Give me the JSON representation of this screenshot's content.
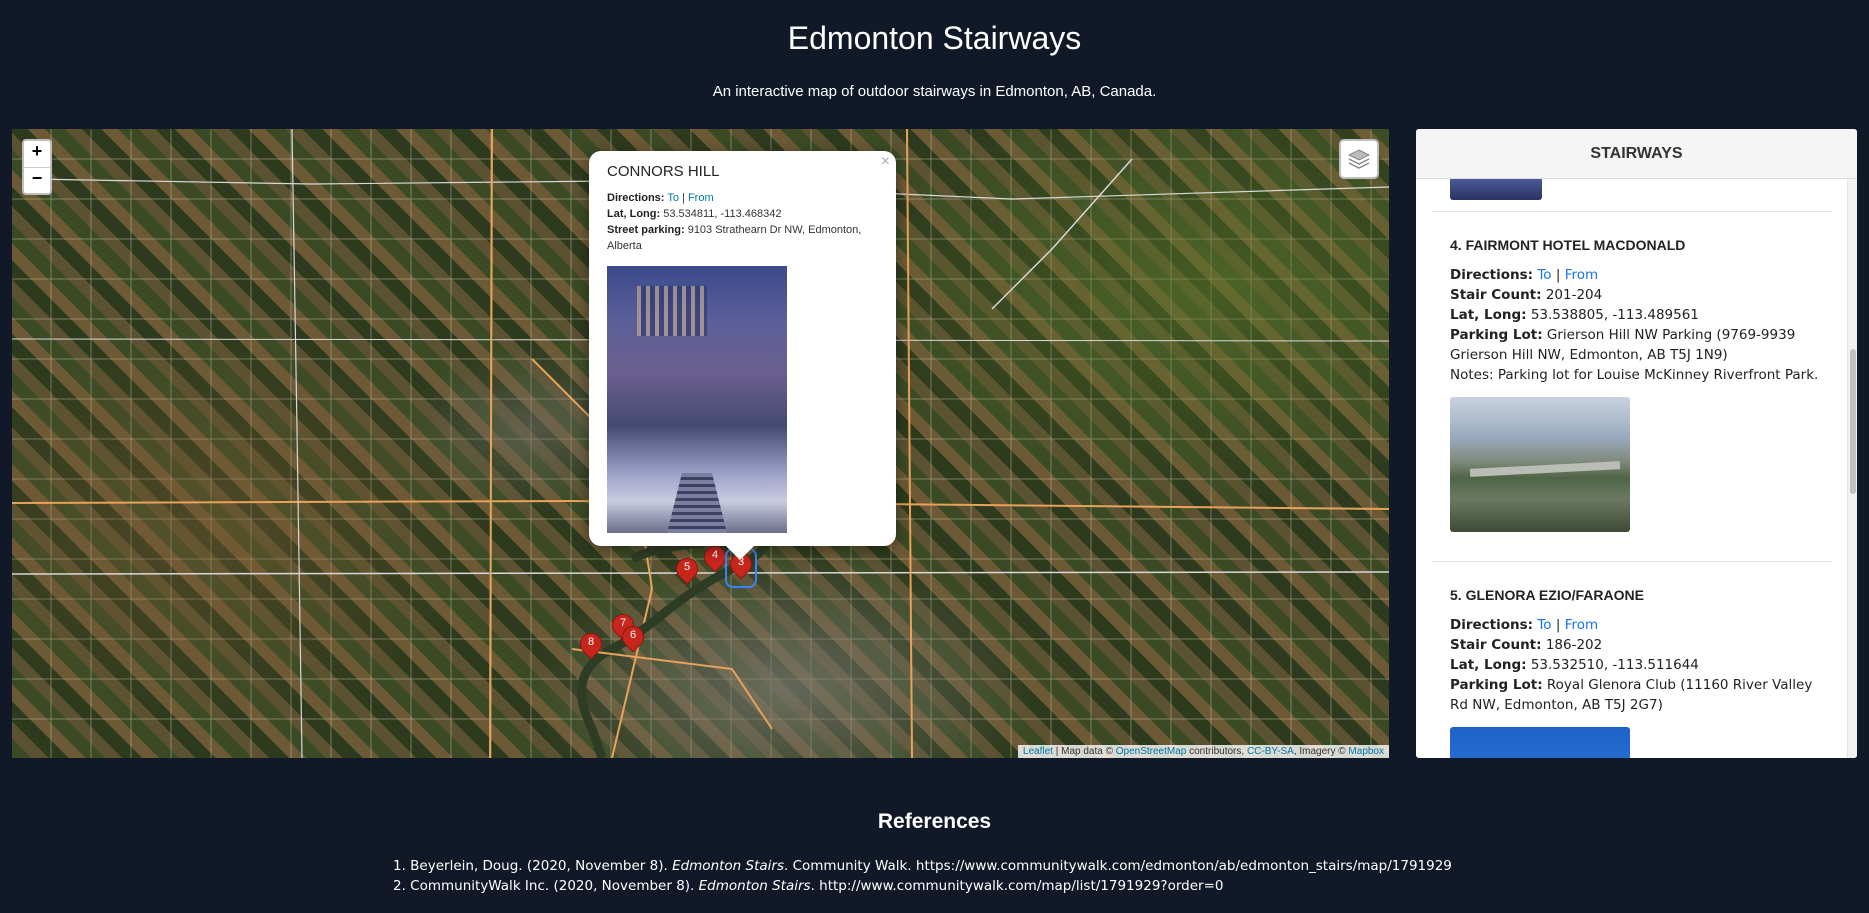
{
  "header": {
    "title": "Edmonton Stairways",
    "subtitle": "An interactive map of outdoor stairways in Edmonton, AB, Canada."
  },
  "map": {
    "zoom_in": "+",
    "zoom_out": "−",
    "layers_icon": "layers-icon",
    "markers": [
      "3",
      "4",
      "5",
      "6",
      "7",
      "8"
    ],
    "marker_color": "#c7261c",
    "attribution": {
      "leaflet": "Leaflet",
      "sep1": " | Map data © ",
      "osm": "OpenStreetMap",
      "contributors": " contributors, ",
      "license": "CC-BY-SA",
      "imagery": ", Imagery © ",
      "mapbox": "Mapbox"
    },
    "popup": {
      "close": "×",
      "title": "CONNORS HILL",
      "directions_label": "Directions:",
      "to": "To",
      "sep": " | ",
      "from": "From",
      "latlong_label": "Lat, Long:",
      "latlong": " 53.534811, -113.468342",
      "parking_label": "Street parking:",
      "parking": " 9103 Strathearn Dr NW, Edmonton, Alberta"
    }
  },
  "sidebar": {
    "title": "STAIRWAYS",
    "entries": [
      {
        "heading": "4. FAIRMONT HOTEL MACDONALD",
        "directions_label": "Directions:",
        "to": "To",
        "sep": "|",
        "from": "From",
        "count_label": "Stair Count:",
        "count": " 201-204",
        "latlong_label": "Lat, Long:",
        "latlong": " 53.538805, -113.489561",
        "parking_label": "Parking Lot:",
        "parking": " Grierson Hill NW Parking (9769-9939 Grierson Hill NW, Edmonton, AB T5J 1N9)",
        "notes": "Notes: Parking lot for Louise McKinney Riverfront Park."
      },
      {
        "heading": "5. GLENORA EZIO/FARAONE",
        "directions_label": "Directions:",
        "to": "To",
        "sep": "|",
        "from": "From",
        "count_label": "Stair Count:",
        "count": " 186-202",
        "latlong_label": "Lat, Long:",
        "latlong": " 53.532510, -113.511644",
        "parking_label": "Parking Lot:",
        "parking": " Royal Glenora Club (11160 River Valley Rd NW, Edmonton, AB T5J 2G7)"
      }
    ]
  },
  "references": {
    "title": "References",
    "items": [
      {
        "pre": "1. Beyerlein, Doug. (2020, November 8). ",
        "title": "Edmonton Stairs",
        "post": ". Community Walk. https://www.communitywalk.com/edmonton/ab/edmonton_stairs/map/1791929"
      },
      {
        "pre": "2. CommunityWalk Inc. (2020, November 8). ",
        "title": "Edmonton Stairs",
        "post": ". http://www.communitywalk.com/map/list/1791929?order=0"
      }
    ]
  }
}
